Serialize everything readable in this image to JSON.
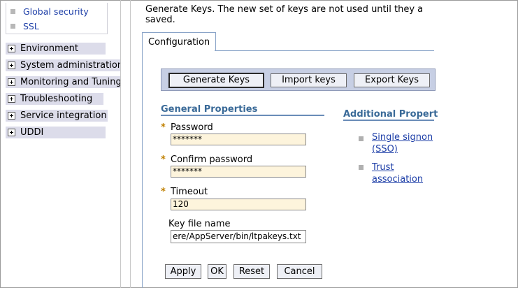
{
  "nav": {
    "sub_items": [
      {
        "label": "Global security"
      },
      {
        "label": "SSL"
      }
    ],
    "items": [
      {
        "label": "Environment"
      },
      {
        "label": "System administration"
      },
      {
        "label": "Monitoring and Tuning"
      },
      {
        "label": "Troubleshooting"
      },
      {
        "label": "Service integration"
      },
      {
        "label": "UDDI"
      }
    ]
  },
  "intro": {
    "line1": "Generate Keys. The new set of keys are not used until they a",
    "line2": "saved."
  },
  "tab": {
    "label": "Configuration"
  },
  "toolbar": {
    "generate": "Generate Keys",
    "import": "Import keys",
    "export": "Export Keys"
  },
  "general": {
    "title": "General Properties",
    "password_label": "Password",
    "password_value": "*******",
    "confirm_label": "Confirm password",
    "confirm_value": "*******",
    "timeout_label": "Timeout",
    "timeout_value": "120",
    "keyfile_label": "Key file name",
    "keyfile_value": "ere/AppServer/bin/ltpakeys.txt",
    "required_marker": "*"
  },
  "additional": {
    "title": "Additional Propert",
    "links": [
      {
        "line1": "Single signon",
        "line2": "(SSO)"
      },
      {
        "line1": "Trust",
        "line2": "association"
      }
    ]
  },
  "actions": {
    "apply": "Apply",
    "ok": "OK",
    "reset": "Reset",
    "cancel": "Cancel"
  }
}
